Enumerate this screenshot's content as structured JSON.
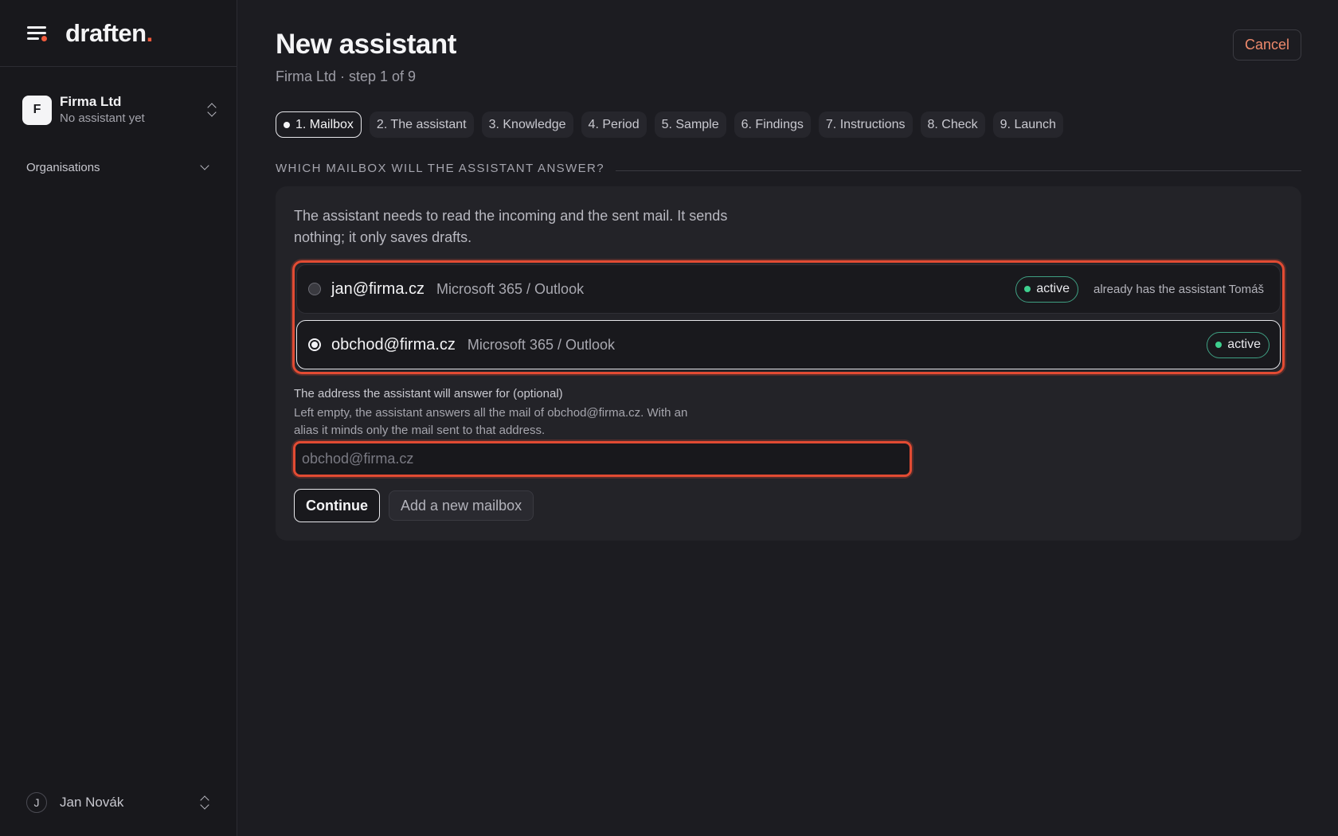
{
  "app": {
    "logo_text": "draften",
    "logo_dot": ".",
    "accent_color": "#f05a3c"
  },
  "sidebar": {
    "org": {
      "initial": "F",
      "name": "Firma Ltd",
      "subtitle": "No assistant yet"
    },
    "organisations_label": "Organisations",
    "user": {
      "initial": "J",
      "name": "Jan Novák"
    }
  },
  "header": {
    "title": "New assistant",
    "subtitle": "Firma Ltd · step 1 of 9",
    "cancel_label": "Cancel"
  },
  "steps": [
    {
      "label": "1. Mailbox",
      "active": true
    },
    {
      "label": "2. The assistant"
    },
    {
      "label": "3. Knowledge"
    },
    {
      "label": "4. Period"
    },
    {
      "label": "5. Sample"
    },
    {
      "label": "6. Findings"
    },
    {
      "label": "7. Instructions"
    },
    {
      "label": "8. Check"
    },
    {
      "label": "9. Launch"
    }
  ],
  "section": {
    "heading": "WHICH MAILBOX WILL THE ASSISTANT ANSWER?",
    "intro": "The assistant needs to read the incoming and the sent mail. It sends nothing; it only saves drafts.",
    "mailboxes": [
      {
        "email": "jan@firma.cz",
        "provider": "Microsoft 365 / Outlook",
        "status": "active",
        "note": "already has the assistant Tomáš",
        "selected": false
      },
      {
        "email": "obchod@firma.cz",
        "provider": "Microsoft 365 / Outlook",
        "status": "active",
        "note": "",
        "selected": true
      }
    ],
    "alias": {
      "label": "The address the assistant will answer for (optional)",
      "help": "Left empty, the assistant answers all the mail of obchod@firma.cz. With an alias it minds only the mail sent to that address.",
      "placeholder": "obchod@firma.cz",
      "value": ""
    },
    "continue_label": "Continue",
    "add_mailbox_label": "Add a new mailbox"
  },
  "colors": {
    "status_active": "#3ecf8e",
    "error_outline": "#e24b33"
  }
}
